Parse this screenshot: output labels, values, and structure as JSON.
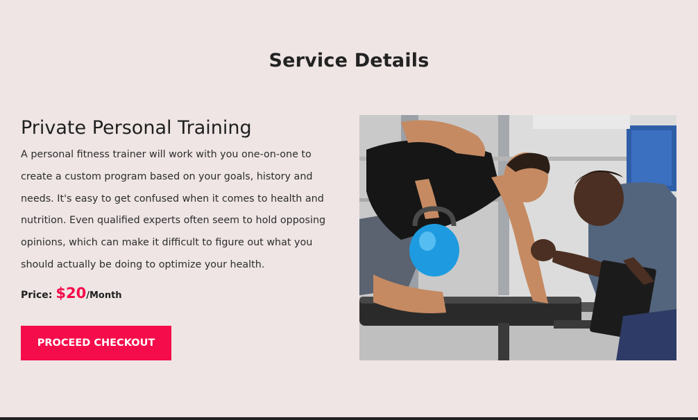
{
  "section": {
    "title": "Service Details"
  },
  "service": {
    "name": "Private Personal Training",
    "description": "A personal fitness trainer will work with you one-on-one to create a custom program based on your goals, history and needs. It's easy to get confused when it comes to health and nutrition. Even qualified experts often seem to hold opposing opinions, which can make it difficult to figure out what you should actually be doing to optimize your health.",
    "price_label": "Price:",
    "price_amount": "$20",
    "price_unit": "/Month"
  },
  "actions": {
    "checkout_label": "PROCEED CHECKOUT"
  },
  "colors": {
    "accent": "#f50c4a",
    "background": "#efe5e5"
  }
}
